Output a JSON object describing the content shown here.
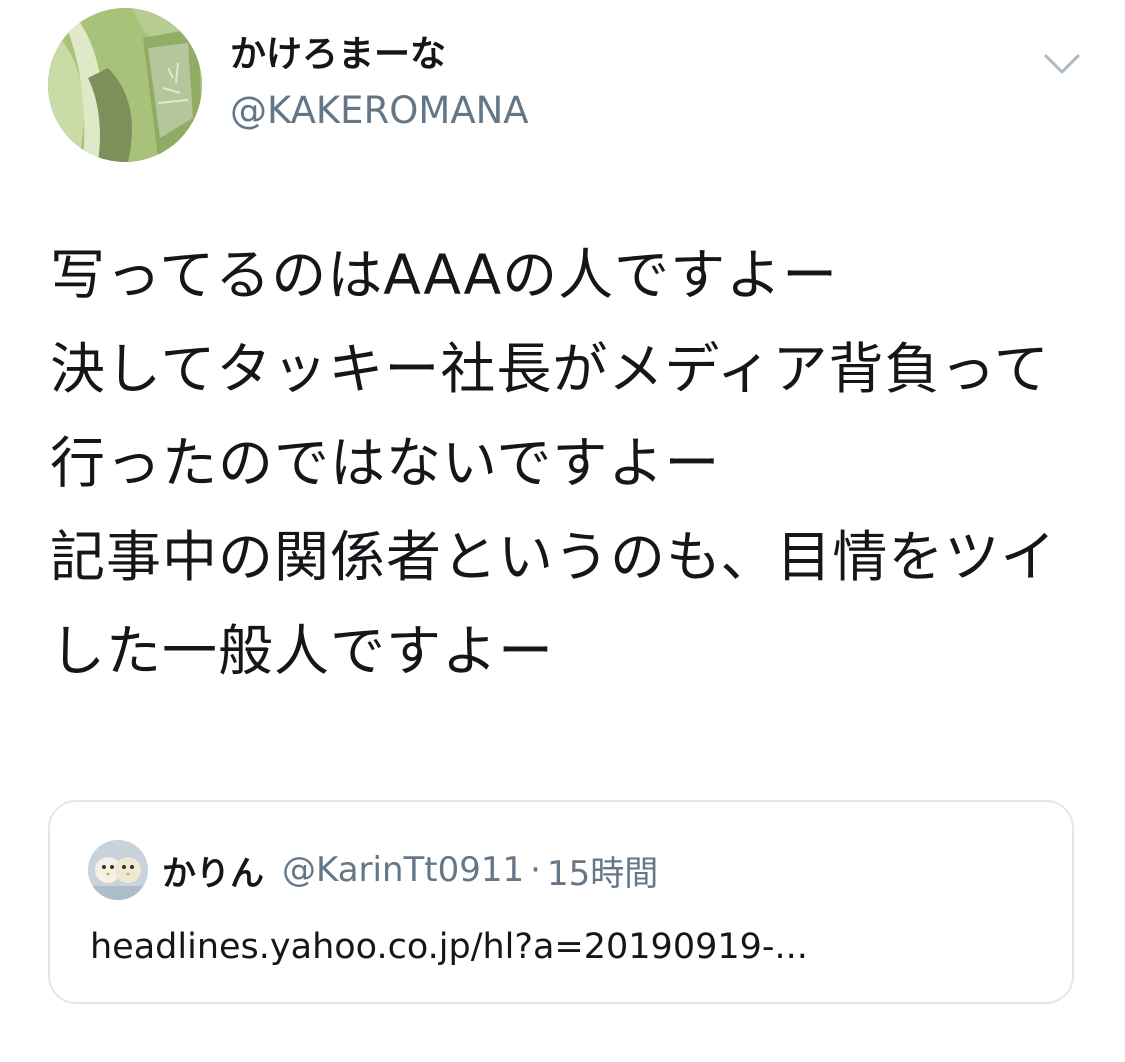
{
  "author": {
    "display_name": "かけろまーな",
    "handle": "@KAKEROMANA",
    "avatar_icon": "profile-photo-icon"
  },
  "menu": {
    "icon": "chevron-down-icon"
  },
  "tweet": {
    "text": "写ってるのはAAAの人ですよー\n決してタッキー社長がメディア背負って行ったのではないですよー\n記事中の関係者というのも、目情をツイした一般人ですよー"
  },
  "quoted_tweet": {
    "display_name": "かりん",
    "handle": "@KarinTt0911",
    "separator": "·",
    "time": "15時間",
    "link_text": "headlines.yahoo.co.jp/hl?a=20190919-...",
    "avatar_icon": "profile-photo-icon"
  },
  "colors": {
    "text_primary": "#14171a",
    "text_secondary": "#657786",
    "border": "#e1e8ed",
    "chevron": "#aab8c2"
  }
}
